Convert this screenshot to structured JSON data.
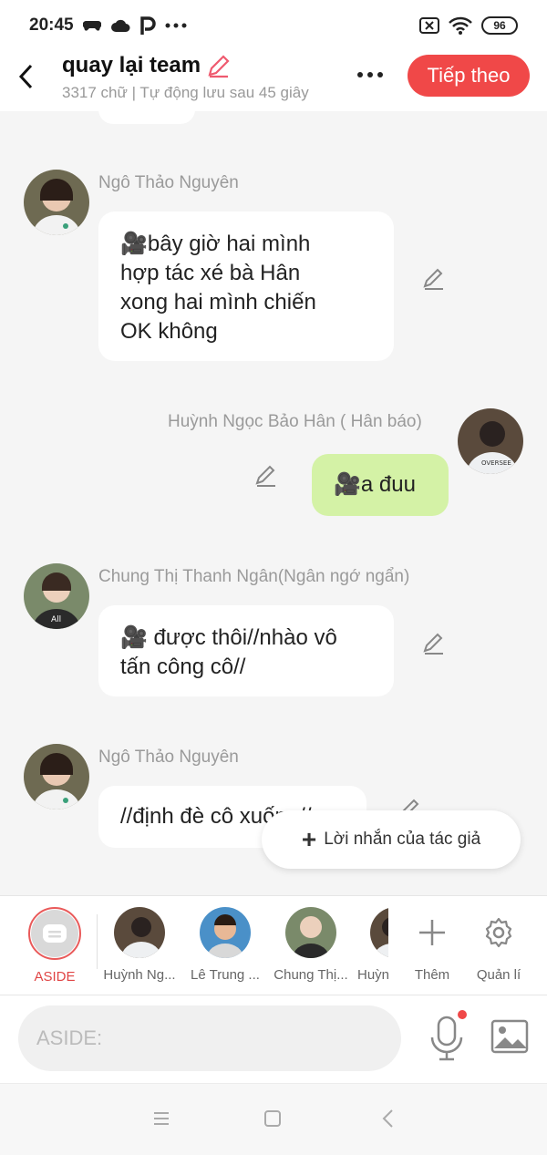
{
  "status": {
    "time": "20:45",
    "battery": "96"
  },
  "header": {
    "title": "quay lại team",
    "subtitle": "3317 chữ | Tự động lưu sau 45 giây",
    "next_label": "Tiếp theo"
  },
  "messages": [
    {
      "sender": "Ngô Thảo Nguyên",
      "lines": [
        "🎥bây giờ hai mình",
        "hợp tác xé bà Hân",
        "xong hai mình chiến",
        "OK không"
      ]
    },
    {
      "sender": "Huỳnh Ngọc Bảo Hân ( Hân báo)",
      "lines": [
        "🎥a đuu"
      ]
    },
    {
      "sender": "Chung Thị Thanh Ngân(Ngân ngớ ngẩn)",
      "lines": [
        "🎥 được thôi//nhào vô",
        "tấn công cô//"
      ]
    },
    {
      "sender": "Ngô Thảo Nguyên",
      "lines": [
        "//định đè cô xuống//"
      ]
    }
  ],
  "author_note_label": "Lời nhắn của tác giả",
  "characters": [
    {
      "label": "ASIDE"
    },
    {
      "label": "Huỳnh Ng..."
    },
    {
      "label": "Lê Trung ..."
    },
    {
      "label": "Chung Thị..."
    },
    {
      "label": "Huỳn"
    }
  ],
  "char_actions": {
    "add_label": "Thêm",
    "manage_label": "Quản lí"
  },
  "input": {
    "placeholder": "ASIDE:"
  },
  "colors": {
    "accent": "#f04848",
    "my_bubble": "#d4f2a6",
    "aside_ring": "#e95a5a"
  }
}
